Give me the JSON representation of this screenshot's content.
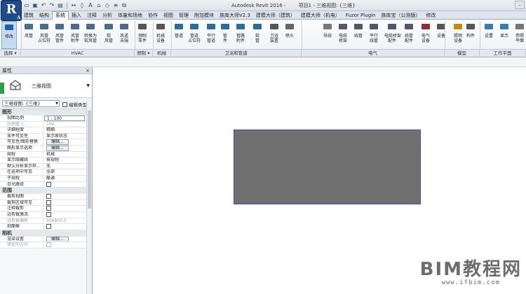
{
  "app": {
    "logo": "R",
    "logo_sub": "A",
    "title": "Autodesk Revit 2016 -",
    "document": "项目1 - 三维视图: {三维}"
  },
  "qat": [
    "open",
    "save",
    "undo",
    "redo",
    "print",
    "measure",
    "tag",
    "text",
    "3d-view",
    "section",
    "thin-lines",
    "close-hidden"
  ],
  "window_controls": [
    "minimize",
    "maximize",
    "close"
  ],
  "tabs": [
    "建筑",
    "结构",
    "系统",
    "插入",
    "注释",
    "分析",
    "体量和场地",
    "协作",
    "视图",
    "管理",
    "附加模块",
    "族库大师V2.3",
    "建模大师（建筑）",
    "建模大师（机电）",
    "Fuzor Plugin",
    "族库宝（公测版）",
    "修改"
  ],
  "active_tab": "系统",
  "ribbon": {
    "tools": [
      {
        "label": "修改",
        "label2": "",
        "icon": "modify-cursor-icon"
      },
      {
        "label": "风管",
        "label2": "",
        "icon": "duct-icon"
      },
      {
        "label": "风管",
        "label2": "占位符",
        "icon": "duct-placeholder-icon"
      },
      {
        "label": "风管",
        "label2": "管件",
        "icon": "duct-fitting-icon"
      },
      {
        "label": "风管",
        "label2": "附件",
        "icon": "duct-accessory-icon"
      },
      {
        "label": "转换为",
        "label2": "软风管",
        "icon": "convert-flex-icon"
      },
      {
        "label": "软",
        "label2": "风管",
        "icon": "flex-duct-icon"
      },
      {
        "label": "风道",
        "label2": "末端",
        "icon": "air-terminal-icon"
      },
      {
        "label": "预制",
        "label2": "零件",
        "icon": "fabrication-part-icon"
      },
      {
        "label": "机械",
        "label2": "设备",
        "icon": "mechanical-equipment-icon"
      },
      {
        "label": "管道",
        "label2": "",
        "icon": "pipe-icon"
      },
      {
        "label": "管道",
        "label2": "占位符",
        "icon": "pipe-placeholder-icon"
      },
      {
        "label": "平行",
        "label2": "管道",
        "icon": "parallel-pipes-icon"
      },
      {
        "label": "管",
        "label2": "件",
        "icon": "pipe-fitting-icon"
      },
      {
        "label": "管路",
        "label2": "附件",
        "icon": "pipe-accessory-icon"
      },
      {
        "label": "软",
        "label2": "管",
        "icon": "flex-pipe-icon"
      },
      {
        "label": "卫浴",
        "label2": "装置",
        "icon": "plumbing-fixture-icon"
      },
      {
        "label": "喷头",
        "label2": "",
        "icon": "sprinkler-icon"
      },
      {
        "label": "导线",
        "label2": "",
        "icon": "wire-icon"
      },
      {
        "label": "电缆",
        "label2": "桥架",
        "icon": "cable-tray-icon"
      },
      {
        "label": "线管",
        "label2": "",
        "icon": "conduit-icon"
      },
      {
        "label": "平行",
        "label2": "线管",
        "icon": "parallel-conduits-icon"
      },
      {
        "label": "电缆桥架",
        "label2": "配件",
        "icon": "cable-tray-fitting-icon"
      },
      {
        "label": "线管",
        "label2": "配件",
        "icon": "conduit-fitting-icon"
      },
      {
        "label": "电气",
        "label2": "设备",
        "icon": "electrical-equipment-icon"
      },
      {
        "label": "设备",
        "label2": "",
        "icon": "device-icon"
      },
      {
        "label": "照明",
        "label2": "设备",
        "icon": "lighting-fixture-icon"
      },
      {
        "label": "构件",
        "label2": "",
        "icon": "component-icon"
      },
      {
        "label": "设置",
        "label2": "",
        "icon": "settings-icon"
      },
      {
        "label": "显示",
        "label2": "",
        "icon": "show-icon"
      },
      {
        "label": "参照",
        "label2": "平面",
        "icon": "ref-plane-icon"
      }
    ],
    "panels": [
      "选择 ▾",
      "HVAC",
      "预制 ▾",
      "机械",
      "卫浴和管道",
      "电气",
      "模型",
      "工作平面"
    ]
  },
  "properties": {
    "title": "属性",
    "close": "×",
    "type_name": "三维视图",
    "instance_selector": "三维视图: {三维}",
    "edit_type": "编辑类型",
    "groups": [
      {
        "name": "图形",
        "rows": [
          {
            "name": "视图比例",
            "value": "1 : 100",
            "kind": "boxed"
          },
          {
            "name": "比例值 1:",
            "value": "100",
            "kind": "dim"
          },
          {
            "name": "详细程度",
            "value": "精细",
            "kind": "text"
          },
          {
            "name": "零件可见性",
            "value": "显示原状态",
            "kind": "text"
          },
          {
            "name": "可见性/图形替换",
            "value": "编辑...",
            "kind": "button"
          },
          {
            "name": "图形显示选项",
            "value": "编辑...",
            "kind": "button"
          },
          {
            "name": "规程",
            "value": "机械",
            "kind": "text"
          },
          {
            "name": "显示隐藏线",
            "value": "按规程",
            "kind": "text"
          },
          {
            "name": "默认分析显示样...",
            "value": "无",
            "kind": "text"
          },
          {
            "name": "在选项中可见",
            "value": "全部",
            "kind": "text"
          },
          {
            "name": "子规程",
            "value": "暖通",
            "kind": "text"
          },
          {
            "name": "日光路径",
            "value": "",
            "kind": "checkbox"
          }
        ]
      },
      {
        "name": "范围",
        "rows": [
          {
            "name": "裁剪视图",
            "value": "",
            "kind": "checkbox"
          },
          {
            "name": "裁剪区域可见",
            "value": "",
            "kind": "checkbox"
          },
          {
            "name": "注释裁剪",
            "value": "",
            "kind": "checkbox"
          },
          {
            "name": "远剪裁激活",
            "value": "",
            "kind": "checkbox"
          },
          {
            "name": "远剪裁偏移",
            "value": "304800.0",
            "kind": "dim"
          },
          {
            "name": "剖面框",
            "value": "",
            "kind": "checkbox"
          }
        ]
      },
      {
        "name": "相机",
        "rows": [
          {
            "name": "渲染设置",
            "value": "编辑...",
            "kind": "button"
          },
          {
            "name": "锁定的方向",
            "value": "",
            "kind": "checkbox-dim"
          }
        ]
      }
    ]
  },
  "watermark": {
    "main": "BIM教程网",
    "url": "www.ifbim.com"
  }
}
